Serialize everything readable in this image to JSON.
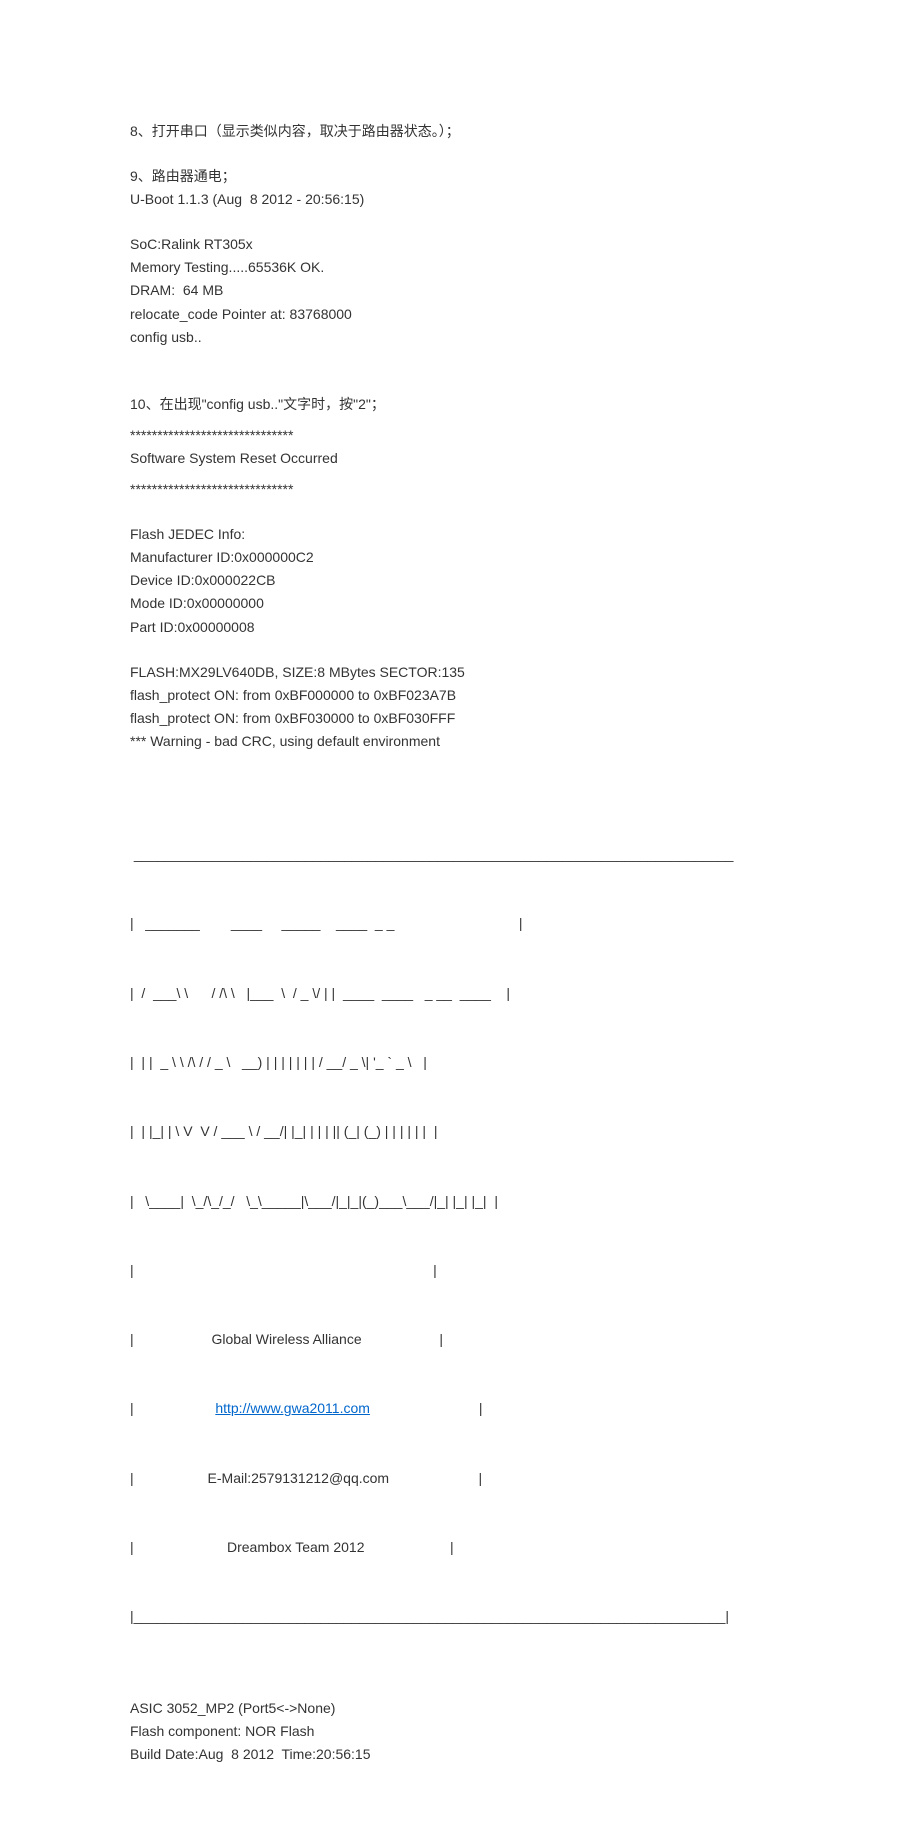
{
  "lines": {
    "l1": "8、打开串口（显示类似内容，取决于路由器状态。）；",
    "l2": "9、路由器通电；",
    "l3": "U-Boot 1.1.3 (Aug  8 2012 - 20:56:15)",
    "l4": "SoC:Ralink RT305x",
    "l5": "Memory Testing.....65536K OK.",
    "l6": "DRAM:  64 MB",
    "l7": "relocate_code Pointer at: 83768000",
    "l8": "config usb..",
    "l9a": "10、在出现\"",
    "l9b": "config usb..",
    "l9c": "\"文字时，按\"2\"；",
    "l10": "******************************",
    "l11": "Software System Reset Occurred",
    "l12": "******************************",
    "l13": "Flash JEDEC Info:",
    "l14": "Manufacturer ID:0x000000C2",
    "l15": "Device ID:0x000022CB",
    "l16": "Mode ID:0x00000000",
    "l17": "Part ID:0x00000008",
    "l18": "FLASH:MX29LV640DB, SIZE:8 MBytes SECTOR:135",
    "l19": "flash_protect ON: from 0xBF000000 to 0xBF023A7B",
    "l20": "flash_protect ON: from 0xBF030000 to 0xBF030FFF",
    "l21": "*** Warning - bad CRC, using default environment",
    "a1": " _____________________________________________________________________________",
    "a2": "|   _______        ____     _____    ____  _ _                                |",
    "a3": "|  /  ___\\ \\      / /\\ \\   |___  \\  / _ \\/ | |  ____  ____   _ __  ____    |",
    "a4": "|  | |  _ \\ \\ /\\ / / _ \\   __) | | | | | | | / __/ _ \\| '_ ` _ \\   |",
    "a5": "|  | |_| | \\ V  V / ___ \\ / __/| |_| | | | || (_| (_) | | | | | |  |",
    "a6": "|   \\____|  \\_/\\_/_/   \\_\\_____|\\___/|_|_|(_)___\\___/|_| |_| |_|  |",
    "a7": "|                                                                             |",
    "a8a": "|                    ",
    "a8b": "Global Wireless Alliance",
    "a8c": "                    |",
    "a9a": "|                     ",
    "a9b": "http://www.gwa2011.com",
    "a9c": "                            |",
    "a10a": "|                   ",
    "a10b": "E-Mail:2579131212@qq.com",
    "a10c": "                       |",
    "a11a": "|                        ",
    "a11b": "Dreambox Team 2012",
    "a11c": "                      |",
    "a12": "|____________________________________________________________________________|",
    "l22": "ASIC 3052_MP2 (Port5<->None)",
    "l23": "Flash component: NOR Flash",
    "l24": "Build Date:Aug  8 2012  Time:20:56:15"
  },
  "link": {
    "href": "http://www.gwa2011.com"
  }
}
